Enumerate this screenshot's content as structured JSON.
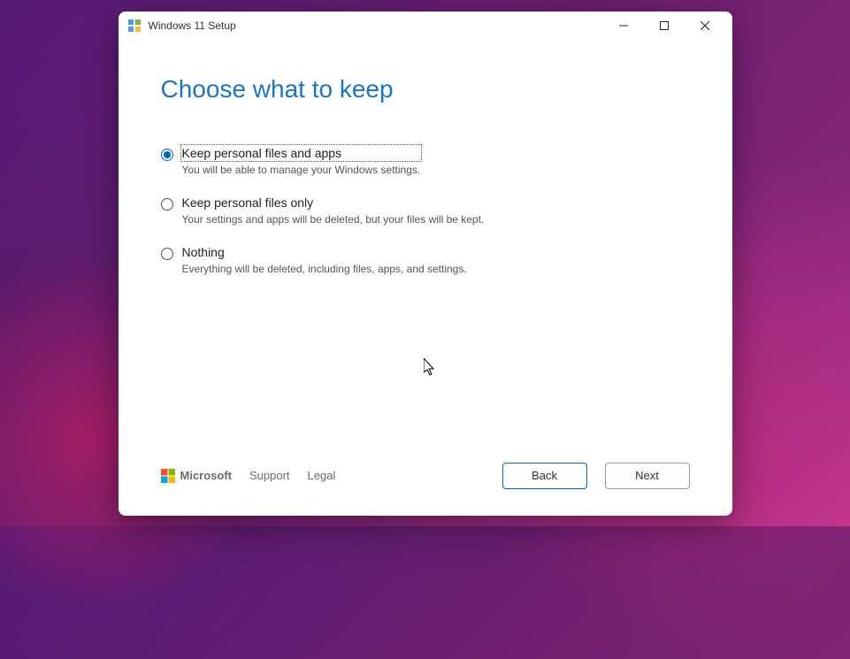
{
  "window": {
    "title": "Windows 11 Setup"
  },
  "heading": "Choose what to keep",
  "options": [
    {
      "label": "Keep personal files and apps",
      "description": "You will be able to manage your Windows settings.",
      "selected": true
    },
    {
      "label": "Keep personal files only",
      "description": "Your settings and apps will be deleted, but your files will be kept.",
      "selected": false
    },
    {
      "label": "Nothing",
      "description": "Everything will be deleted, including files, apps, and settings.",
      "selected": false
    }
  ],
  "footer": {
    "brand": "Microsoft",
    "links": {
      "support": "Support",
      "legal": "Legal"
    },
    "buttons": {
      "back": "Back",
      "next": "Next"
    }
  }
}
